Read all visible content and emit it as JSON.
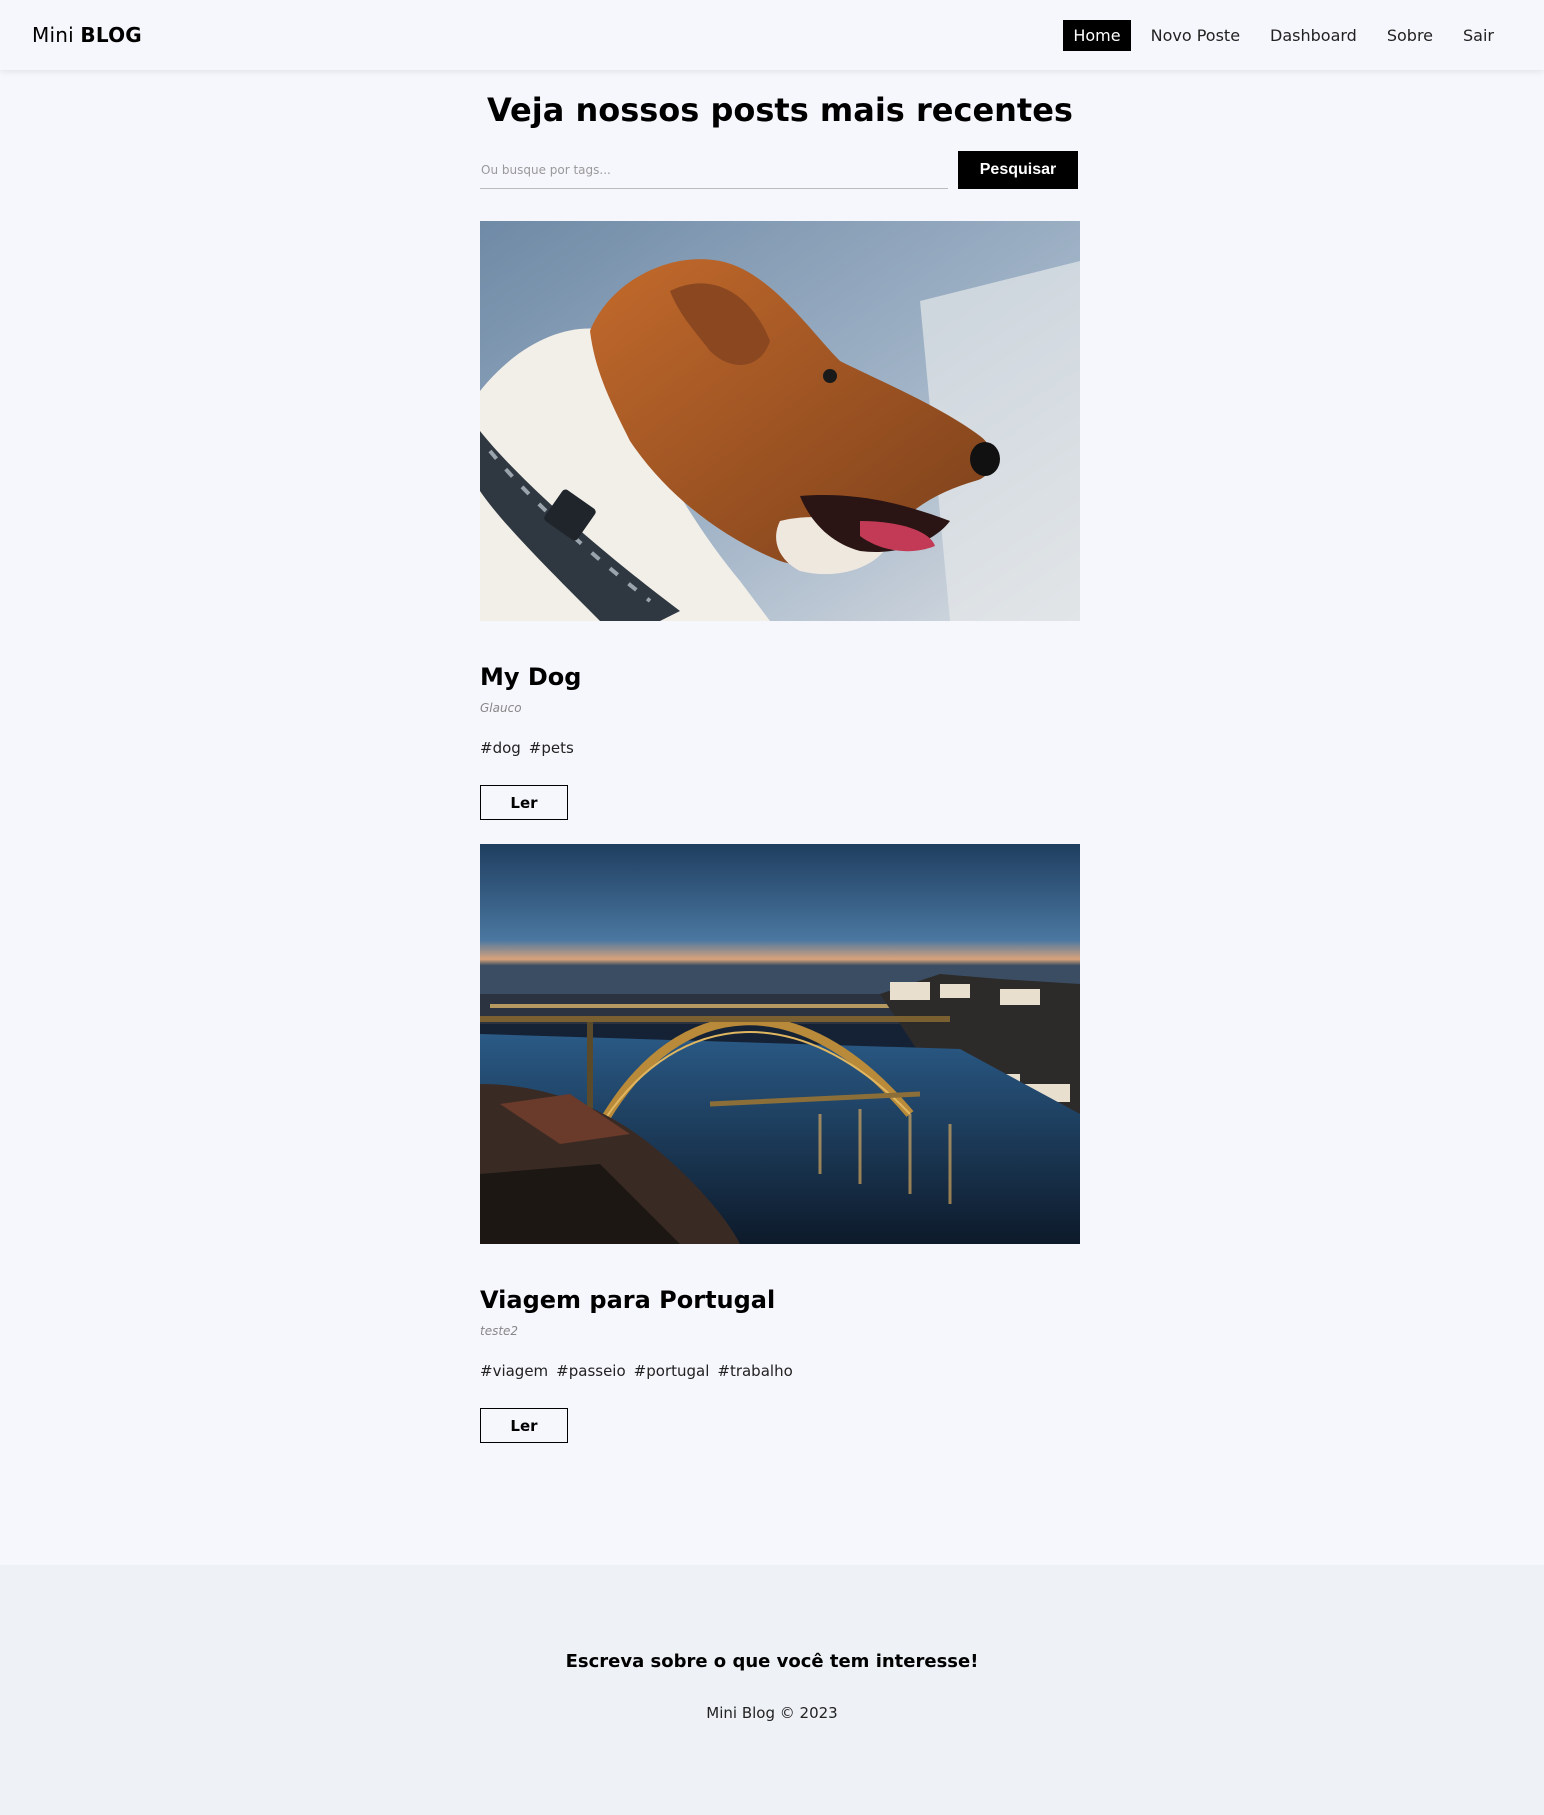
{
  "navbar": {
    "brand_light": "Mini",
    "brand_bold": "BLOG",
    "links": [
      "Home",
      "Novo Poste",
      "Dashboard",
      "Sobre",
      "Sair"
    ],
    "active": "Home"
  },
  "main": {
    "title": "Veja nossos posts mais recentes",
    "search": {
      "placeholder": "Ou busque por tags...",
      "value": "",
      "button_label": "Pesquisar"
    },
    "posts": [
      {
        "title": "My Dog",
        "author": "Glauco",
        "tags": [
          "#dog",
          "#pets"
        ],
        "read_label": "Ler",
        "image_desc": "dog-photo"
      },
      {
        "title": "Viagem para Portugal",
        "author": "teste2",
        "tags": [
          "#viagem",
          "#passeio",
          "#portugal",
          "#trabalho"
        ],
        "read_label": "Ler",
        "image_desc": "porto-bridge-photo"
      }
    ]
  },
  "footer": {
    "headline": "Escreva sobre o que você tem interesse!",
    "copyright": "Mini Blog © 2023"
  }
}
